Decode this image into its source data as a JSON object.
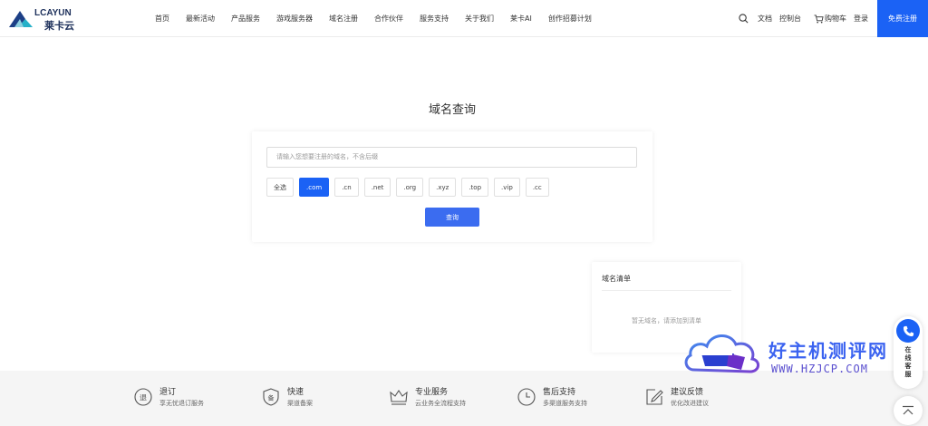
{
  "header": {
    "brand_en": "LCAYUN",
    "brand_cn": "莱卡云",
    "nav": [
      "首页",
      "最新活动",
      "产品服务",
      "游戏服务器",
      "域名注册",
      "合作伙伴",
      "服务支持",
      "关于我们",
      "莱卡AI",
      "创作招募计划"
    ],
    "docs": "文档",
    "console": "控制台",
    "cart": "购物车",
    "login": "登录",
    "register": "免费注册"
  },
  "main": {
    "title": "域名查询",
    "search_placeholder": "请输入您想要注册的域名，不含后缀",
    "tlds": [
      "全选",
      ".com",
      ".cn",
      ".net",
      ".org",
      ".xyz",
      ".top",
      ".vip",
      ".cc"
    ],
    "active_tld": ".com",
    "query_button": "查询"
  },
  "domain_list": {
    "title": "域名清单",
    "empty": "暂无域名，请添加到清单"
  },
  "footer": {
    "features": [
      {
        "title": "退订",
        "desc": "享无忧退订服务",
        "icon": "refund-icon"
      },
      {
        "title": "快速",
        "desc": "渠道备案",
        "icon": "shield-record-icon"
      },
      {
        "title": "专业服务",
        "desc": "云业务全流程支持",
        "icon": "crown-icon"
      },
      {
        "title": "售后支持",
        "desc": "多渠道服务支持",
        "icon": "clock-icon"
      },
      {
        "title": "建议反馈",
        "desc": "优化改进建议",
        "icon": "feedback-edit-icon"
      }
    ]
  },
  "watermark": {
    "cn": "好主机测评网",
    "en": "WWW.HZJCP.COM"
  },
  "side": {
    "service_text": "在线客服"
  },
  "colors": {
    "primary": "#1b62f5",
    "footer_bg": "#f5f5f5"
  }
}
